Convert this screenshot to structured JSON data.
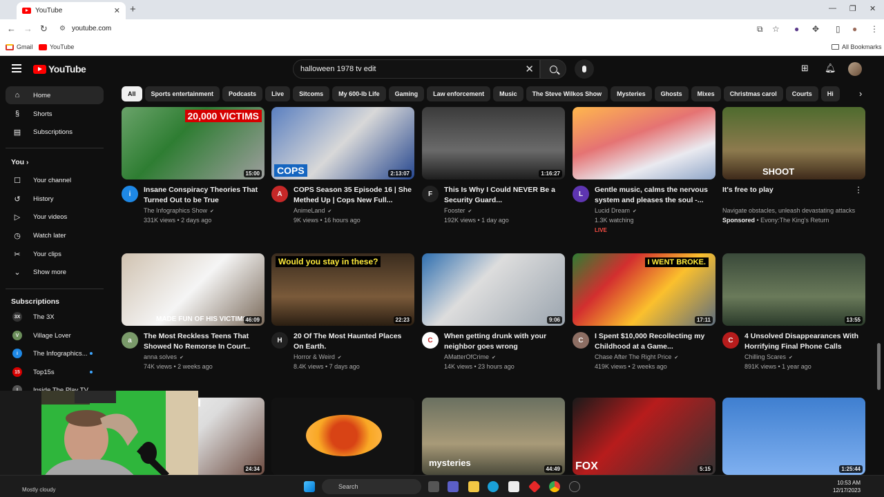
{
  "browser": {
    "tab_title": "YouTube",
    "url": "youtube.com",
    "bookmarks": [
      "Gmail",
      "YouTube"
    ],
    "all_bookmarks": "All Bookmarks"
  },
  "header": {
    "logo_text": "YouTube",
    "search_value": "halloween 1978 tv edit"
  },
  "chips": [
    "All",
    "Sports entertainment",
    "Podcasts",
    "Live",
    "Sitcoms",
    "My 600-lb Life",
    "Gaming",
    "Law enforcement",
    "Music",
    "The Steve Wilkos Show",
    "Mysteries",
    "Ghosts",
    "Mixes",
    "Christmas carol",
    "Courts",
    "Hi"
  ],
  "sidebar": {
    "main": [
      {
        "label": "Home",
        "icon": "home-icon"
      },
      {
        "label": "Shorts",
        "icon": "shorts-icon"
      },
      {
        "label": "Subscriptions",
        "icon": "subscriptions-icon"
      }
    ],
    "you_heading": "You",
    "you_items": [
      {
        "label": "Your channel",
        "icon": "channel-icon"
      },
      {
        "label": "History",
        "icon": "history-icon"
      },
      {
        "label": "Your videos",
        "icon": "videos-icon"
      },
      {
        "label": "Watch later",
        "icon": "clock-icon"
      },
      {
        "label": "Your clips",
        "icon": "scissors-icon"
      },
      {
        "label": "Show more",
        "icon": "chevron-down-icon"
      }
    ],
    "subs_heading": "Subscriptions",
    "subs": [
      {
        "label": "The 3X",
        "color": "#333333",
        "glyph": "3X"
      },
      {
        "label": "Village Lover",
        "color": "#6b8e5a",
        "glyph": "V"
      },
      {
        "label": "The Infographics...",
        "color": "#1e88e5",
        "glyph": "i"
      },
      {
        "label": "Top15s",
        "color": "#d50000",
        "glyph": "15"
      },
      {
        "label": "Inside The Play TV",
        "color": "#555555",
        "glyph": "I"
      }
    ]
  },
  "videos_row1": [
    {
      "title": "Insane Conspiracy Theories That Turned Out to be True",
      "channel": "The Infographics Show",
      "stats": "331K views • 2 days ago",
      "duration": "15:00",
      "caption": "20,000 VICTIMS",
      "avatar_color": "#1e88e5",
      "avatar_glyph": "i"
    },
    {
      "title": "COPS Season 35 Episode 16 | She Methed Up | Cops New Full...",
      "channel": "AnimeLand",
      "stats": "9K views • 16 hours ago",
      "duration": "2:13:07",
      "caption": "COPS",
      "avatar_color": "#c62828",
      "avatar_glyph": "A"
    },
    {
      "title": "This Is Why I Could NEVER Be a Security Guard...",
      "channel": "Fooster",
      "stats": "192K views • 1 day ago",
      "duration": "1:16:27",
      "caption": "",
      "avatar_color": "#212121",
      "avatar_glyph": "F"
    },
    {
      "title": "Gentle music, calms the nervous system and pleases the soul -...",
      "channel": "Lucid Dream",
      "stats": "1.3K watching",
      "duration": "",
      "caption": "",
      "avatar_color": "#5e35b1",
      "avatar_glyph": "L",
      "live": "LIVE"
    },
    {
      "title": "It's free to play",
      "channel": "Navigate obstacles, unleash devastating attacks",
      "stats": "Evony:The King's Return",
      "sponsored": "Sponsored",
      "duration": "",
      "caption": "SHOOT",
      "avatar_color": "",
      "avatar_glyph": ""
    }
  ],
  "videos_row2": [
    {
      "title": "The Most Reckless Teens That Showed No Remorse In Court..",
      "channel": "anna solves",
      "stats": "74K views • 2 weeks ago",
      "duration": "46:09",
      "caption": "MADE FUN OF HIS VICTIMS",
      "avatar_color": "#7a9a6a",
      "avatar_glyph": "a"
    },
    {
      "title": "20 Of The Most Haunted Places On Earth.",
      "channel": "Horror & Weird",
      "stats": "8.4K views • 7 days ago",
      "duration": "22:23",
      "caption": "Would you stay in these?",
      "avatar_color": "#212121",
      "avatar_glyph": "H"
    },
    {
      "title": "When getting drunk with your neighbor goes wrong",
      "channel": "AMatterOfCrime",
      "stats": "14K views • 23 hours ago",
      "duration": "9:06",
      "caption": "",
      "avatar_color": "#ffffff",
      "avatar_glyph": "C"
    },
    {
      "title": "I Spent $10,000 Recollecting my Childhood at a Game...",
      "channel": "Chase After The Right Price",
      "stats": "419K views • 2 weeks ago",
      "duration": "17:11",
      "caption": "I WENT BROKE.",
      "avatar_color": "#8d6e63",
      "avatar_glyph": "C"
    },
    {
      "title": "4 Unsolved Disappearances With Horrifying Final Phone Calls",
      "channel": "Chilling Scares",
      "stats": "891K views • 1 year ago",
      "duration": "13:55",
      "caption": "",
      "avatar_color": "#b71c1c",
      "avatar_glyph": "C"
    }
  ],
  "videos_row3": [
    {
      "duration": "24:34",
      "caption": "hooting server in ng burger"
    },
    {
      "duration": "",
      "caption": ""
    },
    {
      "duration": "44:49",
      "caption": "mysteries"
    },
    {
      "duration": "5:15",
      "caption": "FOX"
    },
    {
      "duration": "1:25:44",
      "caption": ""
    }
  ],
  "taskbar": {
    "search_placeholder": "Search",
    "time": "10:53 AM",
    "date": "12/17/2023",
    "weather": "Mostly cloudy"
  }
}
